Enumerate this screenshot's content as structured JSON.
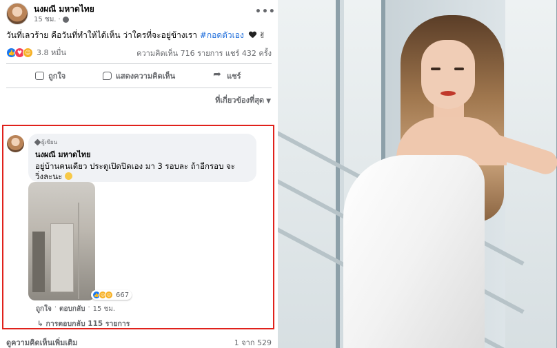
{
  "post": {
    "author": "นงผณี มหาดไทย",
    "time": "15 ชม.",
    "text": "วันที่เลวร้าย คือวันที่ทำให้ได้เห็น ว่าใครที่จะอยู่ข้างเรา",
    "hashtag": "#กอดตัวเอง",
    "reaction_count": "3.8 หมื่น",
    "stats": "ความคิดเห็น 716 รายการ  แชร์ 432 ครั้ง",
    "actions": {
      "like": "ถูกใจ",
      "comment": "แสดงความคิดเห็น",
      "share": "แชร์"
    },
    "sort_label": "ที่เกี่ยวข้องที่สุด"
  },
  "comment": {
    "badge": "ผู้เขียน",
    "author": "นงผณี มหาดไทย",
    "text": "อยู่บ้านคนเดียว ประตูเปิดปิดเอง มา 3 รอบละ ถ้าอีกรอบ จะวิ่งละนะ",
    "photo_reaction_count": "667",
    "like_label": "ถูกใจ",
    "reply_label": "ตอบกลับ",
    "time": "15 ชม.",
    "replies": "การตอบกลับ 115 รายการ"
  },
  "footer": {
    "more_comments": "ดูความคิดเห็นเพิ่มเติม",
    "pager": "1 จาก 529"
  },
  "colors": {
    "highlight_border": "#e0211b",
    "hashtag": "#216fdb",
    "meta_text": "#65676b"
  }
}
